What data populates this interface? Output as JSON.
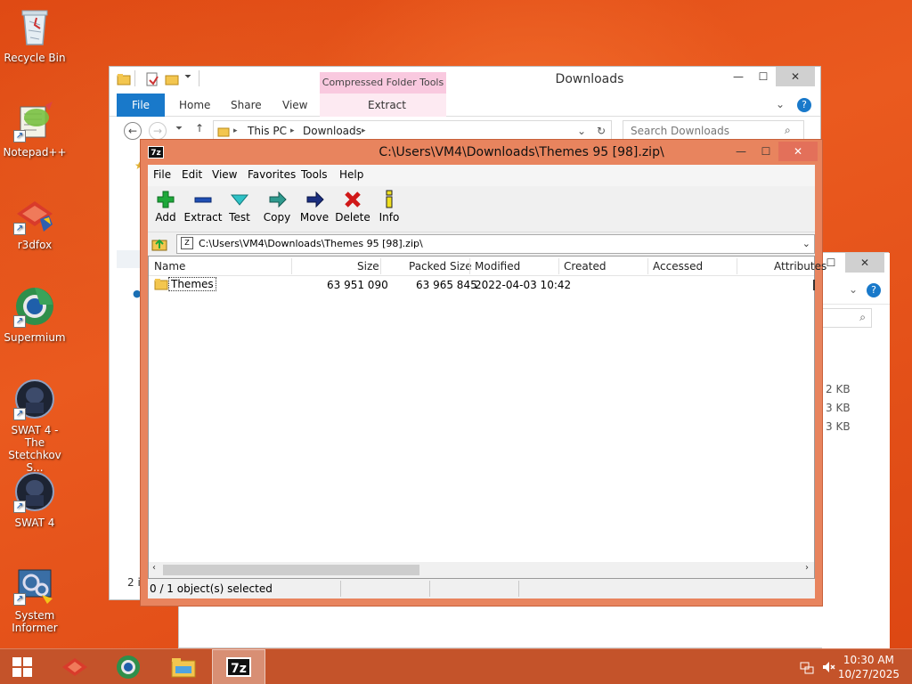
{
  "desktop": {
    "icons": [
      {
        "label": "Recycle Bin"
      },
      {
        "label": "Notepad++"
      },
      {
        "label": "r3dfox"
      },
      {
        "label": "Supermium"
      },
      {
        "label": "SWAT 4 - The Stetchkov S..."
      },
      {
        "label": "SWAT 4"
      },
      {
        "label": "System Informer"
      }
    ]
  },
  "explorer": {
    "title": "Downloads",
    "context_tools": "Compressed Folder Tools",
    "ribbon": {
      "file": "File",
      "home": "Home",
      "share": "Share",
      "view": "View",
      "extract": "Extract"
    },
    "address": {
      "this_pc": "This PC",
      "downloads": "Downloads"
    },
    "search_placeholder": "Search Downloads",
    "status_partial": "2 i"
  },
  "bg_window": {
    "sizes": [
      "2 KB",
      "3 KB",
      "3 KB"
    ]
  },
  "zip": {
    "title": "C:\\Users\\VM4\\Downloads\\Themes 95 [98].zip\\",
    "app_badge": "7z",
    "menu": [
      "File",
      "Edit",
      "View",
      "Favorites",
      "Tools",
      "Help"
    ],
    "toolbar": [
      "Add",
      "Extract",
      "Test",
      "Copy",
      "Move",
      "Delete",
      "Info"
    ],
    "path": "C:\\Users\\VM4\\Downloads\\Themes 95 [98].zip\\",
    "columns": [
      "Name",
      "Size",
      "Packed Size",
      "Modified",
      "Created",
      "Accessed",
      "Attributes"
    ],
    "rows": [
      {
        "name": "Themes",
        "size": "63 951 090",
        "packed": "63 965 845",
        "modified": "2022-04-03 10:42"
      }
    ],
    "status": "0 / 1 object(s) selected"
  },
  "taskbar": {
    "time": "10:30 AM",
    "date": "10/27/2025",
    "active_label": "7z"
  },
  "colors": {
    "desktop": "#e8531b",
    "zip_frame": "#e8845e",
    "explorer_file_tab": "#1979ca",
    "context_tab": "#f9c9df"
  }
}
